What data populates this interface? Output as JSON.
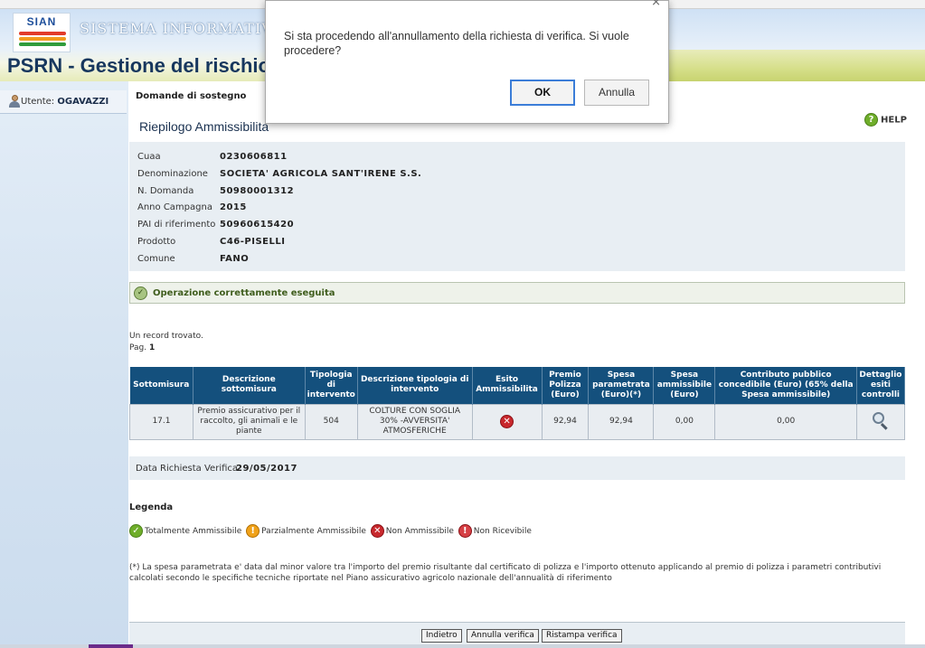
{
  "header": {
    "logo_text": "SIAN",
    "system_name": "SISTEMA INFORMATIVO AGR",
    "app_title": "PSRN - Gestione del rischio"
  },
  "sidebar": {
    "user_label": "Utente:",
    "user_name": "OGAVAZZI"
  },
  "main": {
    "breadcrumb": "Domande di sostegno",
    "title": "Riepilogo Ammissibilita",
    "help_label": "HELP",
    "info": [
      {
        "label": "Cuaa",
        "value": "0230606811"
      },
      {
        "label": "Denominazione",
        "value": "SOCIETA' AGRICOLA SANT'IRENE S.S."
      },
      {
        "label": "N. Domanda",
        "value": "50980001312"
      },
      {
        "label": "Anno Campagna",
        "value": "2015"
      },
      {
        "label": "PAI di riferimento",
        "value": "50960615420"
      },
      {
        "label": "Prodotto",
        "value": "C46-PISELLI"
      },
      {
        "label": "Comune",
        "value": "FANO"
      }
    ],
    "operation_message": "Operazione correttamente eseguita",
    "records_found": "Un record trovato.",
    "page_label": "Pag.",
    "page_number": "1",
    "table": {
      "headers": [
        "Sottomisura",
        "Descrizione sottomisura",
        "Tipologia di intervento",
        "Descrizione tipologia di intervento",
        "Esito Ammissibilita",
        "Premio Polizza (Euro)",
        "Spesa parametrata (Euro)(*)",
        "Spesa ammissibile (Euro)",
        "Contributo pubblico concedibile (Euro) (65% della Spesa ammissibile)",
        "Dettaglio esiti controlli"
      ],
      "rows": [
        {
          "sottomisura": "17.1",
          "descrizione": "Premio assicurativo per il raccolto, gli animali e le piante",
          "tipologia": "504",
          "descrizione_tipologia": "COLTURE CON SOGLIA 30% -AVVERSITA' ATMOSFERICHE",
          "esito": "non-ammissibile",
          "premio": "92,94",
          "spesa_parametrata": "92,94",
          "spesa_ammissibile": "0,00",
          "contributo": "0,00"
        }
      ]
    },
    "data_richiesta_label": "Data Richiesta Verifica",
    "data_richiesta_value": "29/05/2017",
    "legend": {
      "title": "Legenda",
      "items": [
        {
          "label": "Totalmente Ammissibile",
          "color": "#6fae2a"
        },
        {
          "label": "Parzialmente Ammissibile",
          "color": "#f0a21a"
        },
        {
          "label": "Non Ammissibile",
          "color": "#c8282d"
        },
        {
          "label": "Non Ricevibile",
          "color": "#d64045"
        }
      ]
    },
    "footnote": "(*) La spesa parametrata e' data dal minor valore tra l'importo del premio risultante dal certificato di polizza e l'importo ottenuto applicando al premio di polizza i parametri contributivi calcolati secondo le specifiche tecniche riportate nel Piano assicurativo agricolo nazionale dell'annualità di riferimento",
    "buttons": {
      "back": "Indietro",
      "cancel_verification": "Annulla verifica",
      "reprint_verification": "Ristampa verifica"
    }
  },
  "dialog": {
    "message": "Si sta procedendo all'annullamento della richiesta di verifica. Si vuole procedere?",
    "ok_label": "OK",
    "cancel_label": "Annulla"
  }
}
